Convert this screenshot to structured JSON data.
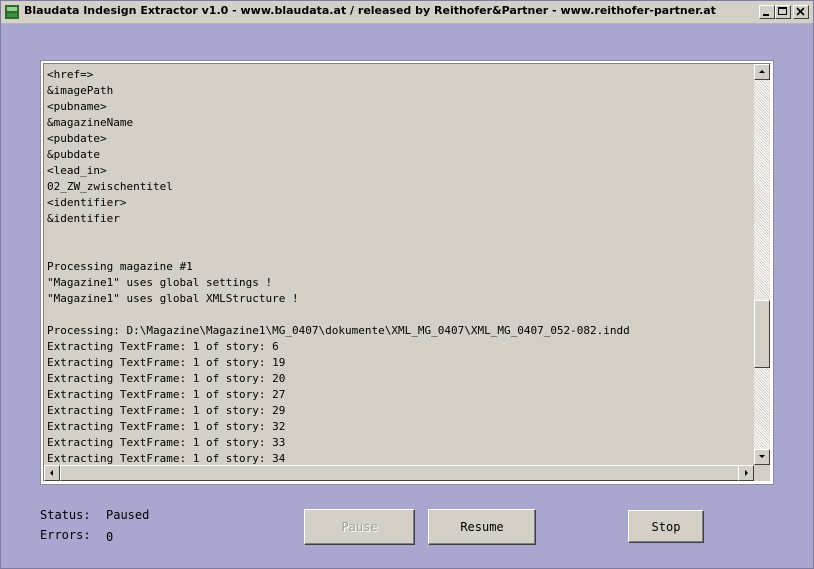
{
  "window": {
    "title": "Blaudata Indesign Extractor v1.0  - www.blaudata.at / released by Reithofer&Partner - www.reithofer-partner.at"
  },
  "log": {
    "lines": [
      "<href=>",
      "&imagePath",
      "<pubname>",
      "&magazineName",
      "<pubdate>",
      "&pubdate",
      "<lead_in>",
      "02_ZW_zwischentitel",
      "<identifier>",
      "&identifier",
      "",
      "",
      "Processing magazine #1",
      "\"Magazine1\" uses global settings !",
      "\"Magazine1\" uses global XMLStructure !",
      "",
      "Processing: D:\\Magazine\\Magazine1\\MG_0407\\dokumente\\XML_MG_0407\\XML_MG_0407_052-082.indd",
      "Extracting TextFrame: 1 of story: 6",
      "Extracting TextFrame: 1 of story: 19",
      "Extracting TextFrame: 1 of story: 20",
      "Extracting TextFrame: 1 of story: 27",
      "Extracting TextFrame: 1 of story: 29",
      "Extracting TextFrame: 1 of story: 32",
      "Extracting TextFrame: 1 of story: 33",
      "Extracting TextFrame: 1 of story: 34"
    ]
  },
  "status": {
    "status_label": "Status:",
    "status_value": "Paused",
    "errors_label": "Errors:",
    "errors_value": "0"
  },
  "buttons": {
    "pause": "Pause",
    "resume": "Resume",
    "stop": "Stop"
  },
  "colors": {
    "background": "#a9a6cf",
    "control_face": "#d4d0c8",
    "disabled_text": "#a09e98"
  }
}
